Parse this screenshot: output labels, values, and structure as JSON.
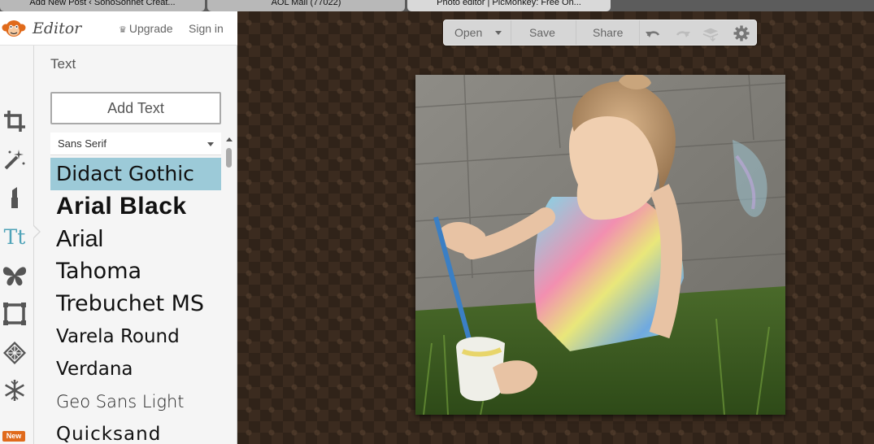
{
  "browser_tabs": [
    {
      "label": "Add New Post ‹ SonoSonnet Creat..."
    },
    {
      "label": "AOL Mail (77022)"
    },
    {
      "label": "Photo editor | PicMonkey: Free On..."
    }
  ],
  "header": {
    "logo_text": "Editor",
    "upgrade_label": "Upgrade",
    "signin_label": "Sign in"
  },
  "rail": {
    "items": [
      {
        "icon": "crop-icon"
      },
      {
        "icon": "magic-wand-icon"
      },
      {
        "icon": "lipstick-icon"
      },
      {
        "icon": "text-icon",
        "label": "Tt"
      },
      {
        "icon": "butterfly-icon"
      },
      {
        "icon": "frame-icon"
      },
      {
        "icon": "texture-icon"
      },
      {
        "icon": "snowflake-icon",
        "badge": "New"
      }
    ]
  },
  "panel": {
    "title": "Text",
    "add_text_label": "Add Text",
    "font_category": "Sans Serif",
    "fonts": [
      {
        "name": "Didact Gothic",
        "selected": true
      },
      {
        "name": "Arial Black"
      },
      {
        "name": "Arial"
      },
      {
        "name": "Tahoma"
      },
      {
        "name": "Trebuchet MS"
      },
      {
        "name": "Varela Round"
      },
      {
        "name": "Verdana"
      },
      {
        "name": "Geo Sans Light"
      },
      {
        "name": "Quicksand"
      }
    ]
  },
  "toolbar": {
    "open_label": "Open",
    "save_label": "Save",
    "share_label": "Share",
    "icons": [
      "undo-icon",
      "redo-icon",
      "layers-icon",
      "gear-icon"
    ]
  },
  "colors": {
    "selected_font_bg": "#9ccad8",
    "canvas_bg": "#3b2b1f",
    "new_badge": "#e06a1b"
  }
}
